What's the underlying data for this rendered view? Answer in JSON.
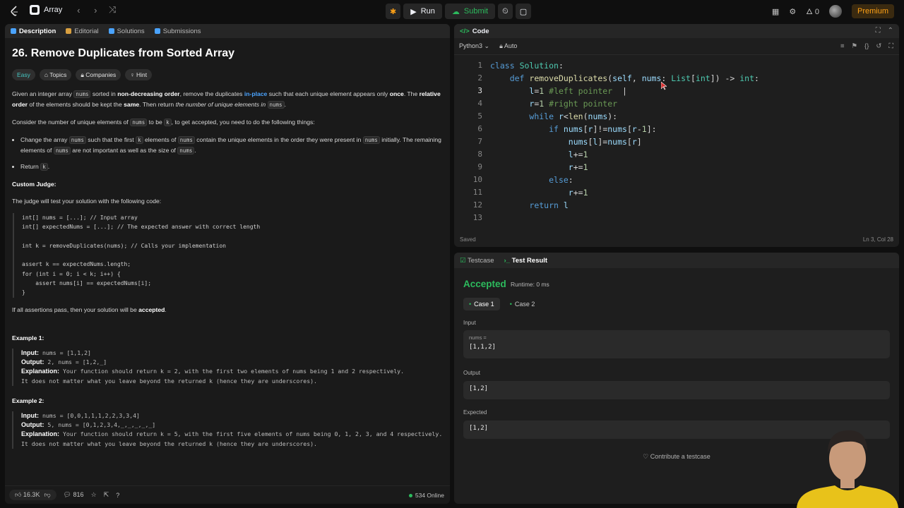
{
  "topbar": {
    "title": "Array",
    "run_label": "Run",
    "submit_label": "Submit",
    "fire_count": "0",
    "premium_label": "Premium"
  },
  "left_tabs": [
    "Description",
    "Editorial",
    "Solutions",
    "Submissions"
  ],
  "problem": {
    "title": "26. Remove Duplicates from Sorted Array",
    "tags": [
      "Easy",
      "Topics",
      "Companies",
      "Hint"
    ],
    "custom_judge_heading": "Custom Judge:",
    "judge_intro": "The judge will test your solution with the following code:",
    "judge_code": "int[] nums = [...]; // Input array\nint[] expectedNums = [...]; // The expected answer with correct length\n\nint k = removeDuplicates(nums); // Calls your implementation\n\nassert k == expectedNums.length;\nfor (int i = 0; i < k; i++) {\n    assert nums[i] == expectedNums[i];\n}",
    "example1_title": "Example 1:",
    "example1_input": "nums = [1,1,2]",
    "example1_output": "2, nums = [1,2,_]",
    "example1_expl": "Your function should return k = 2, with the first two elements of nums being 1 and 2 respectively.",
    "example1_note": "It does not matter what you leave beyond the returned k (hence they are underscores).",
    "example2_title": "Example 2:",
    "example2_input": "nums = [0,0,1,1,1,2,2,3,3,4]",
    "example2_output": "5, nums = [0,1,2,3,4,_,_,_,_,_]",
    "example2_expl": "Your function should return k = 5, with the first five elements of nums being 0, 1, 2, 3, and 4 respectively.",
    "example2_note": "It does not matter what you leave beyond the returned k (hence they are underscores).",
    "label_input": "Input:",
    "label_output": "Output:",
    "label_expl": "Explanation:"
  },
  "footer": {
    "likes": "16.3K",
    "comments": "816",
    "online": "534 Online"
  },
  "code": {
    "panel_title": "Code",
    "language": "Python3",
    "mode": "Auto",
    "line_numbers": [
      "1",
      "2",
      "3",
      "4",
      "5",
      "6",
      "7",
      "8",
      "9",
      "10",
      "11",
      "12",
      "13"
    ],
    "status": "Saved",
    "position": "Ln 3, Col 28"
  },
  "result": {
    "tab_testcase": "Testcase",
    "tab_result": "Test Result",
    "verdict": "Accepted",
    "runtime": "Runtime: 0 ms",
    "cases": [
      "Case 1",
      "Case 2"
    ],
    "input_label": "Input",
    "input_var": "nums =",
    "input_value": "[1,1,2]",
    "output_label": "Output",
    "output_value": "[1,2]",
    "expected_label": "Expected",
    "expected_value": "[1,2]",
    "contribute": "Contribute a testcase"
  },
  "colors": {
    "accent_green": "#2cbb5d",
    "premium_orange": "#ffa116",
    "easy_teal": "#46c6c2"
  }
}
